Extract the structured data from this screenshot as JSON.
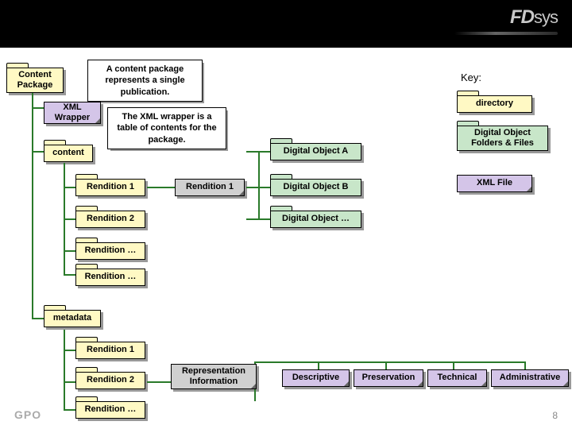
{
  "header": {
    "logo_main": "FD",
    "logo_sub": "sys"
  },
  "callouts": {
    "content_package": "A content package represents a single publication.",
    "xml_wrapper": "The XML wrapper is a table of contents for the package."
  },
  "nodes": {
    "content_package": "Content Package",
    "xml_wrapper": "XML Wrapper",
    "content": "content",
    "rendition_1a": "Rendition 1",
    "rendition_2a": "Rendition 2",
    "rendition_more_a": "Rendition …",
    "metadata": "metadata",
    "rendition_1b": "Rendition 1",
    "rendition_2b": "Rendition 2",
    "rendition_more_b": "Rendition …",
    "rendition_1_file": "Rendition 1",
    "digital_obj_a": "Digital Object A",
    "digital_obj_b": "Digital Object B",
    "digital_obj_more": "Digital Object …",
    "rep_info": "Representation Information",
    "descriptive": "Descriptive",
    "preservation": "Preservation",
    "technical": "Technical",
    "administrative": "Administrative"
  },
  "key": {
    "title": "Key:",
    "directory": "directory",
    "digital_obj": "Digital Object Folders & Files",
    "xml_file": "XML File"
  },
  "footer": {
    "gpo": "GPO",
    "page": "8"
  }
}
